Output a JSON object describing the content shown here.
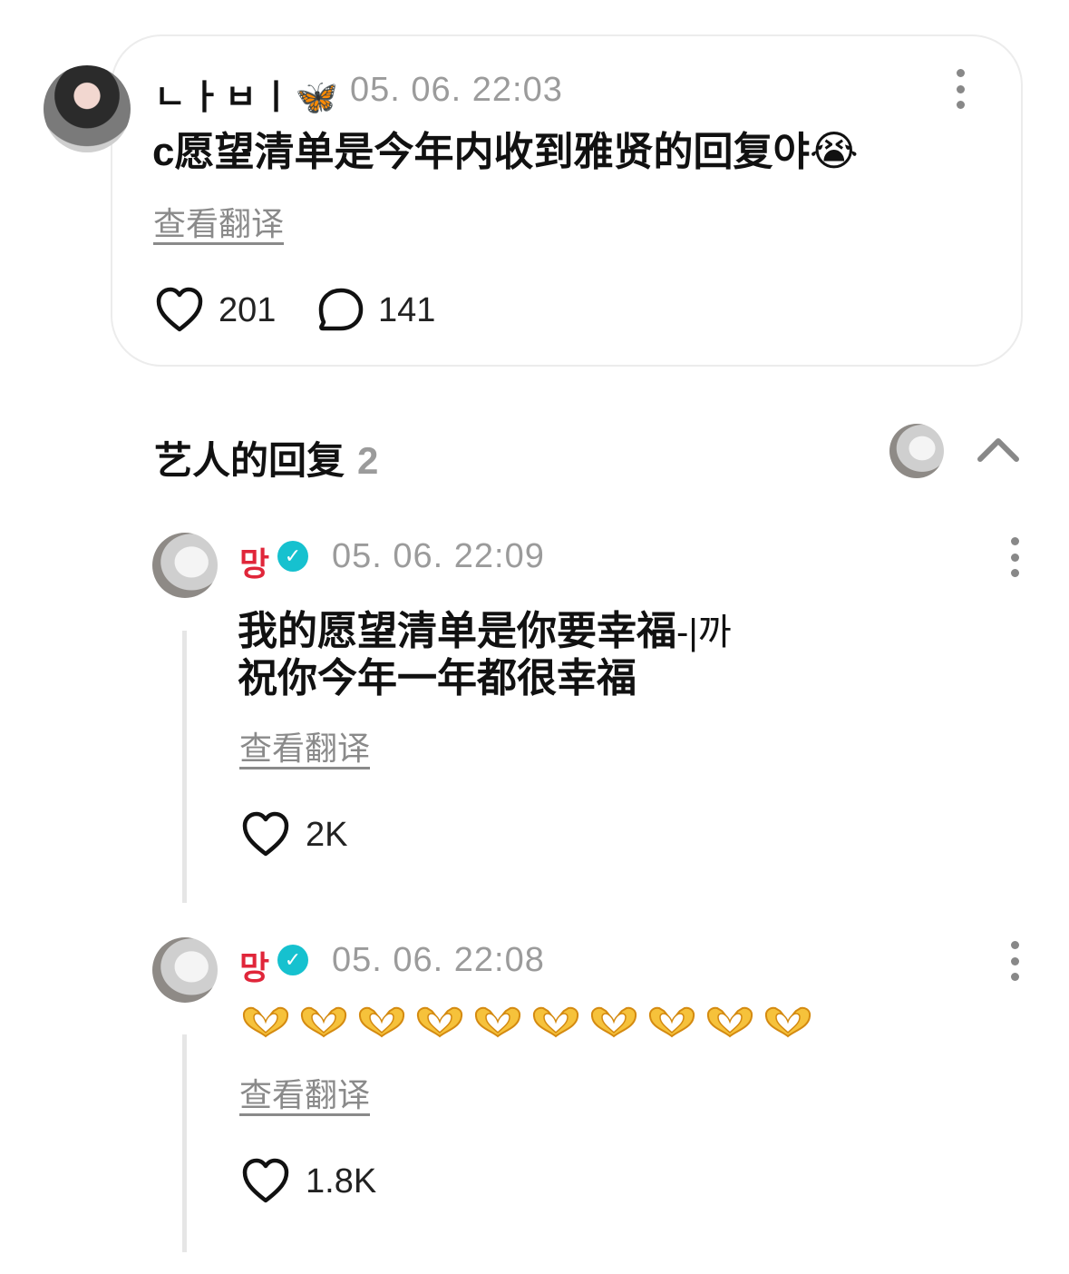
{
  "main_comment": {
    "username": "ㄴㅏㅂㅣ🦋",
    "time": "05. 06. 22:03",
    "text": "c愿望清单是今年内收到雅贤的回复야",
    "text_emoji": "😭",
    "translate_label": "查看翻译",
    "likes": "201",
    "replies": "141"
  },
  "replies_section": {
    "title": "艺人的回复",
    "count": "2"
  },
  "replies": [
    {
      "name": "망",
      "time": "05. 06. 22:09",
      "line1": "我的愿望清单是你要幸福",
      "line1_suffix": "-|까",
      "line2": "祝你今年一年都很幸福",
      "translate_label": "查看翻译",
      "likes": "2K"
    },
    {
      "name": "망",
      "time": "05. 06. 22:08",
      "emoji_count": 10,
      "translate_label": "查看翻译",
      "likes": "1.8K"
    }
  ],
  "icons": {
    "like": "heart-icon",
    "reply": "comment-bubble-icon",
    "more": "more-vertical-icon",
    "collapse": "chevron-up-icon",
    "verified": "verified-badge-icon",
    "heart_hands": "heart-hands-emoji"
  },
  "colors": {
    "artist_name": "#e0263a",
    "verified": "#16c1cf",
    "muted": "#9b9b9b"
  }
}
